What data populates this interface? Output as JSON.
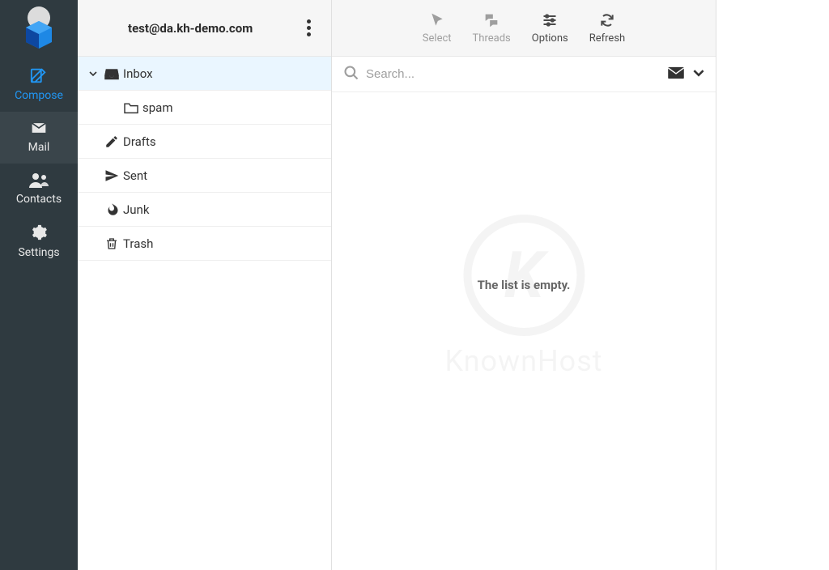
{
  "account": {
    "email": "test@da.kh-demo.com"
  },
  "nav": {
    "compose": "Compose",
    "mail": "Mail",
    "contacts": "Contacts",
    "settings": "Settings"
  },
  "folders": {
    "inbox": "Inbox",
    "spam": "spam",
    "drafts": "Drafts",
    "sent": "Sent",
    "junk": "Junk",
    "trash": "Trash"
  },
  "toolbar": {
    "select": "Select",
    "threads": "Threads",
    "options": "Options",
    "refresh": "Refresh"
  },
  "search": {
    "placeholder": "Search..."
  },
  "messages": {
    "empty_text": "The list is empty."
  },
  "watermark": {
    "text": "KnownHost"
  }
}
